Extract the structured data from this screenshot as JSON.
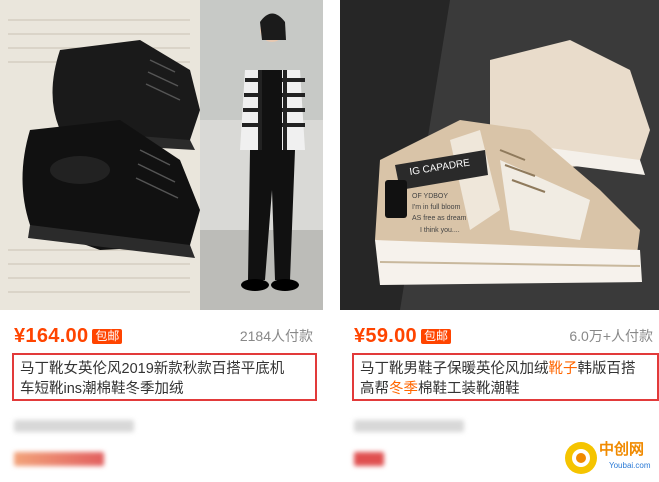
{
  "products": [
    {
      "price": "¥164.00",
      "free_shipping": "包邮",
      "sold": "2184人付款",
      "title_line1": "马丁靴女英伦风2019新款秋款百搭平底机",
      "title_line2": "车短靴ins潮棉鞋冬季加绒",
      "image_alt": "black-leather-martin-boots-photo"
    },
    {
      "price": "¥59.00",
      "free_shipping": "包邮",
      "sold": "6.0万+人付款",
      "title_part1": "马丁靴男鞋子保暖英伦风加绒",
      "title_hl1": "靴子",
      "title_part2": "韩版百搭",
      "title_part3": "高帮",
      "title_hl2": "冬季",
      "title_part4": "棉鞋工装靴潮鞋",
      "image_alt": "beige-high-top-sneaker-boots-photo",
      "shoe_print": [
        "IG CAPADRE",
        "OF YDBOY",
        "I'm in full bloom",
        "AS free as dream",
        "I think you...."
      ]
    }
  ],
  "watermark": {
    "text": "中创网",
    "sub": "Youbai.com"
  },
  "colors": {
    "price": "#ff4400",
    "highlight": "#ff6600",
    "frame": "#e23a3a"
  }
}
